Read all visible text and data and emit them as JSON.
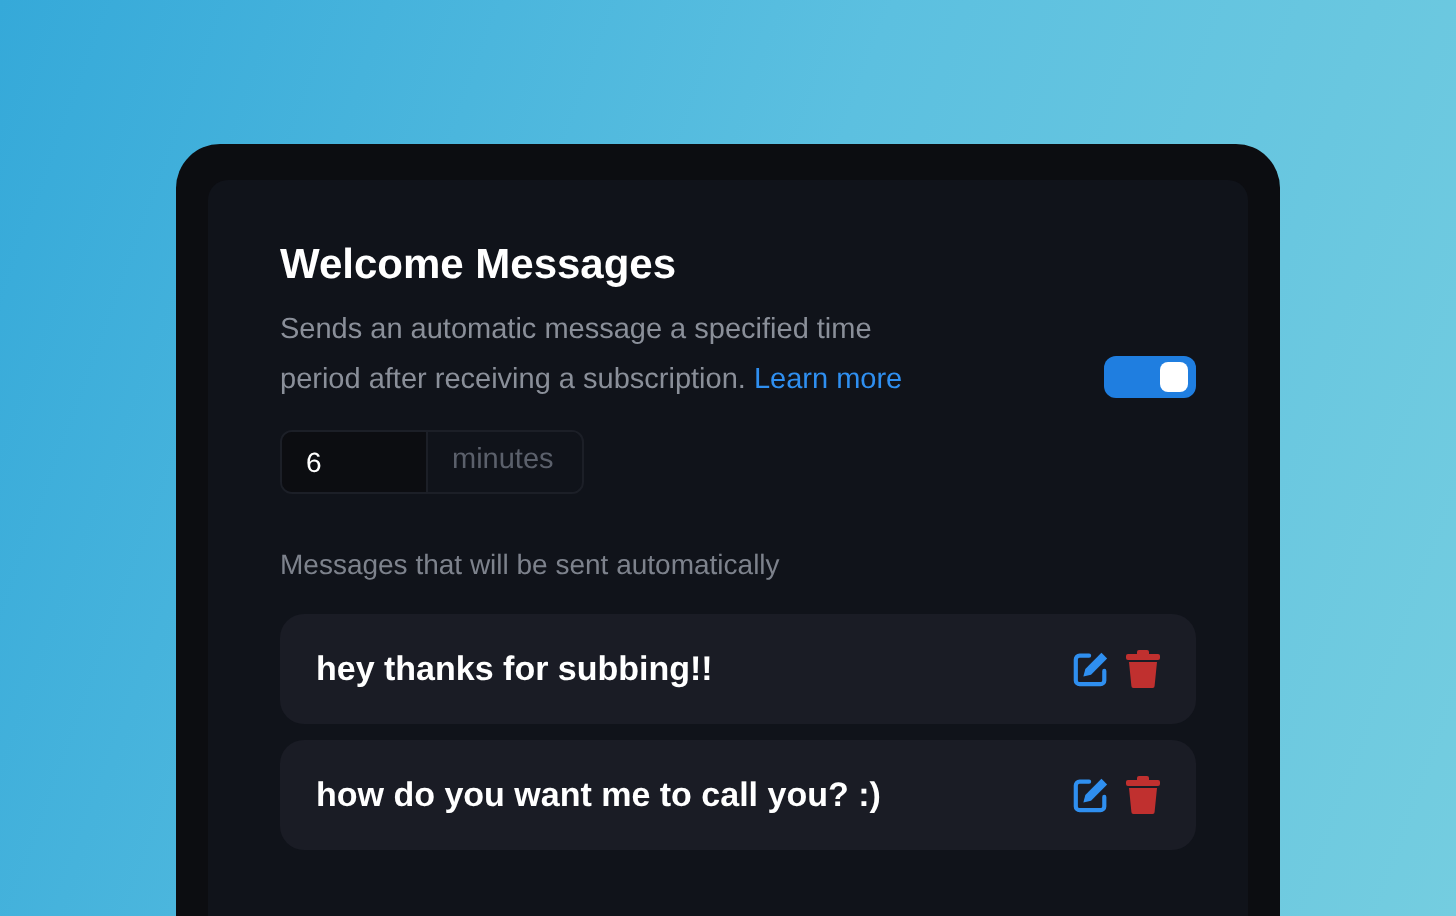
{
  "section": {
    "title": "Welcome Messages",
    "description": "Sends an automatic message a specified time period after receiving a subscription.",
    "link": "Learn more",
    "enabled": true
  },
  "delay": {
    "value": "6",
    "unit": "minutes"
  },
  "messages_label": "Messages that will be sent automatically",
  "messages": [
    {
      "text": "hey thanks for subbing!!"
    },
    {
      "text": "how do you want me to call you? :)"
    }
  ]
}
